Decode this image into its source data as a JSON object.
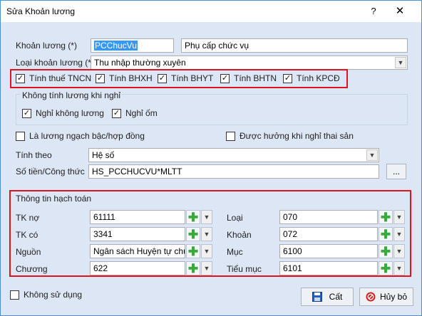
{
  "window": {
    "title": "Sửa Khoản lương",
    "help_glyph": "?",
    "close_glyph": "✕"
  },
  "form": {
    "khoan_luong": {
      "label": "Khoản lương (*)",
      "code": "PCChucVu",
      "name": "Phụ cấp chức vụ"
    },
    "loai_khoan_luong": {
      "label": "Loại khoản lương (*)",
      "value": "Thu nhập thường xuyên"
    },
    "deductions": [
      {
        "label": "Tính thuế TNCN",
        "checked": true
      },
      {
        "label": "Tính BHXH",
        "checked": true
      },
      {
        "label": "Tính BHYT",
        "checked": true
      },
      {
        "label": "Tính BHTN",
        "checked": true
      },
      {
        "label": "Tính KPCĐ",
        "checked": true
      }
    ],
    "khong_tinh_luong": {
      "title": "Không tính lương khi nghỉ",
      "items": [
        {
          "label": "Nghỉ không lương",
          "checked": true
        },
        {
          "label": "Nghỉ ốm",
          "checked": true
        }
      ]
    },
    "la_luong_ngach": {
      "label": "Là lương ngạch bậc/hợp đồng",
      "checked": false
    },
    "duoc_huong": {
      "label": "Được hưởng khi nghỉ thai sản",
      "checked": false
    },
    "tinh_theo": {
      "label": "Tính theo",
      "value": "Hệ số"
    },
    "so_tien": {
      "label": "Số tiền/Công thức",
      "value": "HS_PCCHUCVU*MLTT",
      "browse_label": "..."
    }
  },
  "hach_toan": {
    "title": "Thông tin hạch toán",
    "left": [
      {
        "label": "TK nợ",
        "value": "61111"
      },
      {
        "label": "TK có",
        "value": "3341"
      },
      {
        "label": "Nguồn",
        "value": "Ngân sách Huyện tự chủ"
      },
      {
        "label": "Chương",
        "value": "622"
      }
    ],
    "right": [
      {
        "label": "Loại",
        "value": "070"
      },
      {
        "label": "Khoản",
        "value": "072"
      },
      {
        "label": "Mục",
        "value": "6100"
      },
      {
        "label": "Tiểu mục",
        "value": "6101"
      }
    ]
  },
  "footer": {
    "khong_su_dung": {
      "label": "Không sử dụng",
      "checked": false
    },
    "save_label": "Cất",
    "cancel_label": "Hủy bỏ"
  },
  "colors": {
    "background": "#dce6f4",
    "highlight_border": "#e0141e",
    "plus_green": "#3aa83a",
    "save_blue": "#2060c0",
    "cancel_red": "#d42020"
  },
  "icons": {
    "plus": "plus-icon",
    "dropdown": "chevron-down-icon",
    "save": "floppy-disk-icon",
    "cancel": "cancel-circle-icon"
  }
}
